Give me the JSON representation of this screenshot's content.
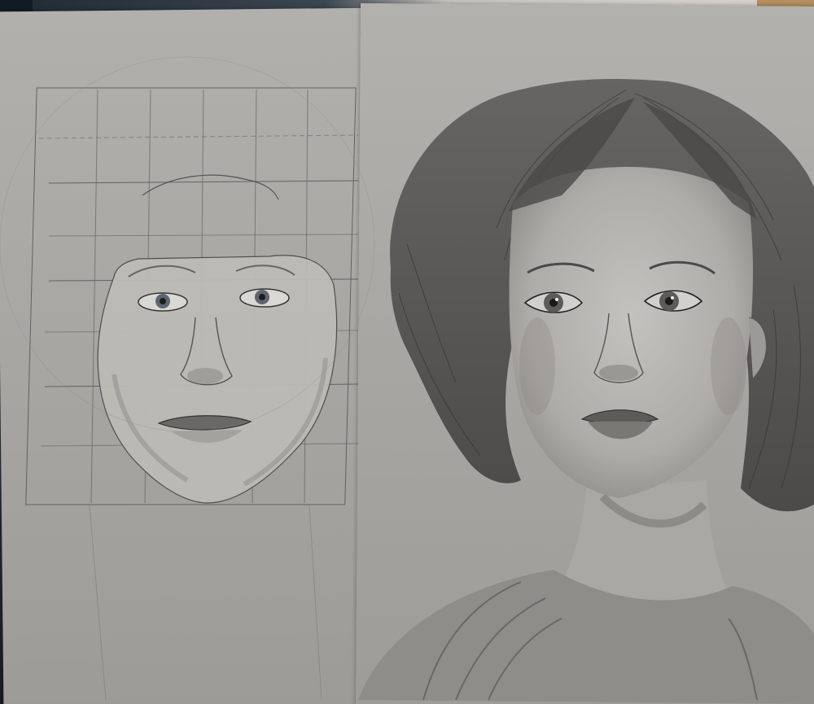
{
  "scene": {
    "description_colors": {
      "paper": "#a8a6a2",
      "graphite": "#3a3a3a",
      "desk": "#8a6a44"
    },
    "notes": {
      "corner_note_1": "",
      "corner_note_2": ""
    }
  }
}
